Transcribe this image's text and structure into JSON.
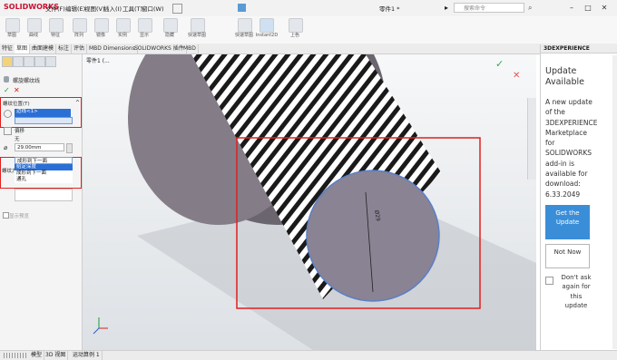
{
  "app": {
    "logo": "SOLIDWORKS",
    "doc_title": "零件1 *"
  },
  "menus": [
    "文件(F)",
    "编辑(E)",
    "视图(V)",
    "插入(I)",
    "工具(T)",
    "窗口(W)"
  ],
  "search": {
    "placeholder": "搜索命令"
  },
  "ribbon": {
    "items": [
      "草图",
      "曲线",
      "特征",
      "阵列",
      "镜像",
      "实例",
      "显示",
      "隐藏",
      "快速草图",
      "Instant2D",
      "上色",
      "草图"
    ]
  },
  "tabs": [
    "特征",
    "草图",
    "曲面建模",
    "标注",
    "评估",
    "MBD Dimensions",
    "SOLIDWORKS 插件",
    "MBD"
  ],
  "property_manager": {
    "title": "螺旋螺纹线",
    "ok": "✓",
    "cancel": "✕",
    "section_thread_location": "螺纹位置(T)",
    "edge_value": "边线<1>",
    "offset_label": "偏移",
    "offset_value": "无",
    "diameter_value": "29.00mm",
    "end_condition_label": "螺纹方法",
    "end_condition_selected": "成形到下一面",
    "options": [
      "给定深度",
      "成形到下一面",
      "通孔"
    ],
    "show_preview": "显示预览"
  },
  "viewport": {
    "breadcrumb": "零件1 (...",
    "dimension_label": "Ø29"
  },
  "dexperience": {
    "header": "3DEXPERIENCE",
    "title": "Update Available",
    "message": "A new update of the 3DEXPERIENCE Marketplace for SOLIDWORKS add-in is available for download: 6.33.2049",
    "get_update": "Get the Update",
    "not_now": "Not Now",
    "dont_ask": "Don't ask again for this update"
  },
  "status_tabs": [
    "模型",
    "3D 视图",
    "运动算例 1"
  ],
  "colors": {
    "accent": "#3a8ed8",
    "highlight": "#e0201f",
    "brand": "#c8102e"
  }
}
